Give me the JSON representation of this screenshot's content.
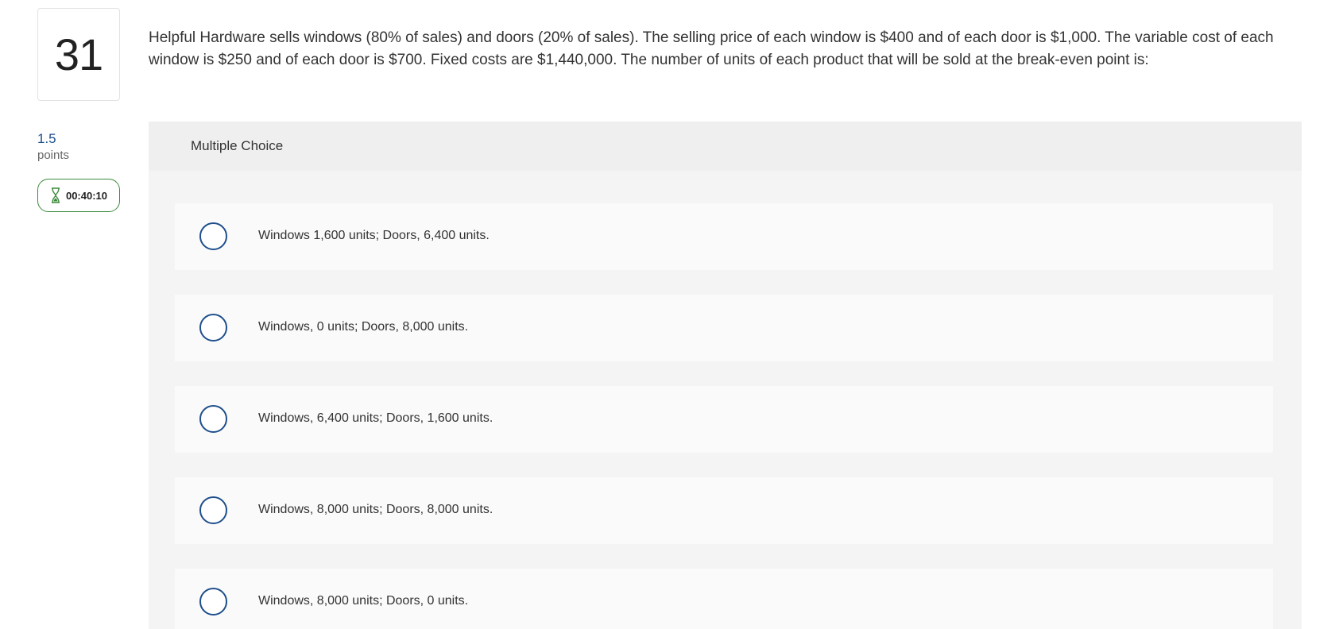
{
  "question": {
    "number": "31",
    "points_value": "1.5",
    "points_label": "points",
    "timer": "00:40:10",
    "text": "Helpful Hardware sells windows (80% of sales) and doors (20% of sales). The selling price of each window is $400 and of each door is $1,000. The variable cost of each window is $250 and of each door is $700. Fixed costs are $1,440,000. The number of units of each product that will be sold at the break-even point is:"
  },
  "answer_panel": {
    "title": "Multiple Choice",
    "options": [
      {
        "label": "Windows 1,600 units; Doors, 6,400 units."
      },
      {
        "label": "Windows, 0 units; Doors, 8,000 units."
      },
      {
        "label": "Windows, 6,400 units; Doors, 1,600 units."
      },
      {
        "label": "Windows, 8,000 units; Doors, 8,000 units."
      },
      {
        "label": "Windows, 8,000 units; Doors, 0 units."
      }
    ]
  },
  "icons": {
    "timer_icon": "hourglass-icon",
    "option_icon": "radio-button-icon"
  },
  "colors": {
    "accent_blue": "#1e4f8c",
    "timer_green": "#3c8a3c",
    "panel_bg": "#f4f4f4",
    "option_bg": "#fafafa"
  }
}
